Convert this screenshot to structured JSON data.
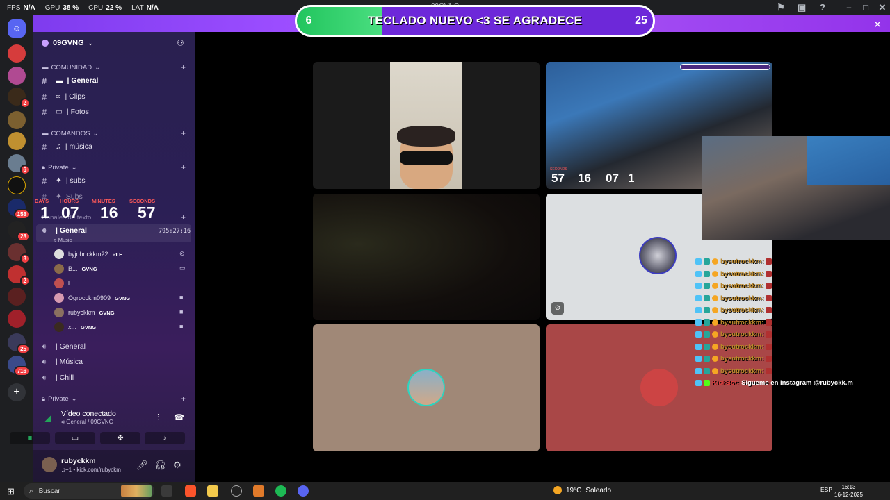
{
  "top_stats": {
    "fps_label": "FPS",
    "fps_value": "N/A",
    "gpu_label": "GPU",
    "gpu_value": "38 %",
    "cpu_label": "CPU",
    "cpu_value": "22 %",
    "lat_label": "LAT",
    "lat_value": "N/A"
  },
  "window_caption": "09GVNG",
  "banner": {
    "left_number": "6",
    "text": "TECLADO NUEVO <3 SE AGRADECE",
    "right_number": "25",
    "progress_fraction": 0.24
  },
  "guild": {
    "name": "09GVNG"
  },
  "categories": [
    {
      "label": "COMUNIDAD"
    },
    {
      "label": "COMANDOS"
    },
    {
      "label": "Private"
    },
    {
      "label": "Canales de texto"
    },
    {
      "label": "Private"
    }
  ],
  "channels": {
    "general": "| General",
    "clips": "| Clips",
    "fotos": "| Fotos",
    "musica": "| música",
    "subs": "| subs",
    "subs2": "Subs"
  },
  "countdown": {
    "days_label": "DAYS",
    "hours_label": "HOURS",
    "minutes_label": "MINUTES",
    "seconds_label": "SECONDS",
    "days": "1",
    "hours": "07",
    "minutes": "16",
    "seconds": "57"
  },
  "voice": {
    "active_channel": "| General",
    "timer": "795:27:16",
    "activity": "Music",
    "users": [
      {
        "name": "byjohnckkm22",
        "tag": "PLF"
      },
      {
        "name": "B...",
        "tag": "GVNG"
      },
      {
        "name": "l...",
        "tag": ""
      },
      {
        "name": "Ogrocckm0909",
        "tag": "GVNG"
      },
      {
        "name": "rubyckkm",
        "tag": "GVNG"
      },
      {
        "name": "x...",
        "tag": "GVNG"
      }
    ],
    "other_channels": [
      "| General",
      "| Música",
      "| Chill"
    ]
  },
  "voice_connected": {
    "title": "Vídeo conectado",
    "subtitle": "General / 09GVNG"
  },
  "user_panel": {
    "name": "rubyckkm",
    "status": "♫+1 • kick.com/rubyckm"
  },
  "server_badges": [
    "2",
    "6",
    "158",
    "28",
    "3",
    "2",
    "25",
    "716"
  ],
  "chat": {
    "lines": [
      {
        "user": "bysutrockkm:"
      },
      {
        "user": "bysutrockkm:"
      },
      {
        "user": "bysutrockkm:"
      },
      {
        "user": "bysutrockkm:"
      },
      {
        "user": "bysutrockkm:"
      },
      {
        "user": "bysutrockkm:"
      },
      {
        "user": "bysutrockkm:"
      },
      {
        "user": "bysutrockkm:"
      },
      {
        "user": "bysutrockkm:"
      },
      {
        "user": "bysutrockkm:"
      }
    ],
    "bot_user": "KickBot:",
    "bot_message": "Sigueme en instagram @rubyckk.m"
  },
  "stream_countdown": {
    "label_1": "DAYS",
    "label_2": "HOURS",
    "label_3": "MINUTES",
    "label_4": "SECONDS",
    "d": "1",
    "h": "07",
    "m": "16",
    "s": "57"
  },
  "taskbar": {
    "search_placeholder": "Buscar",
    "weather_temp": "19°C",
    "weather_text": "Soleado",
    "lang": "ESP",
    "time": "16:13",
    "date": "16-12-2025"
  },
  "colors": {
    "accent": "#9b4dff",
    "banner_fill": "#22c55e",
    "tile_beige": "#a08877",
    "tile_red": "#a94747",
    "tile_white": "#dcdfe1"
  }
}
